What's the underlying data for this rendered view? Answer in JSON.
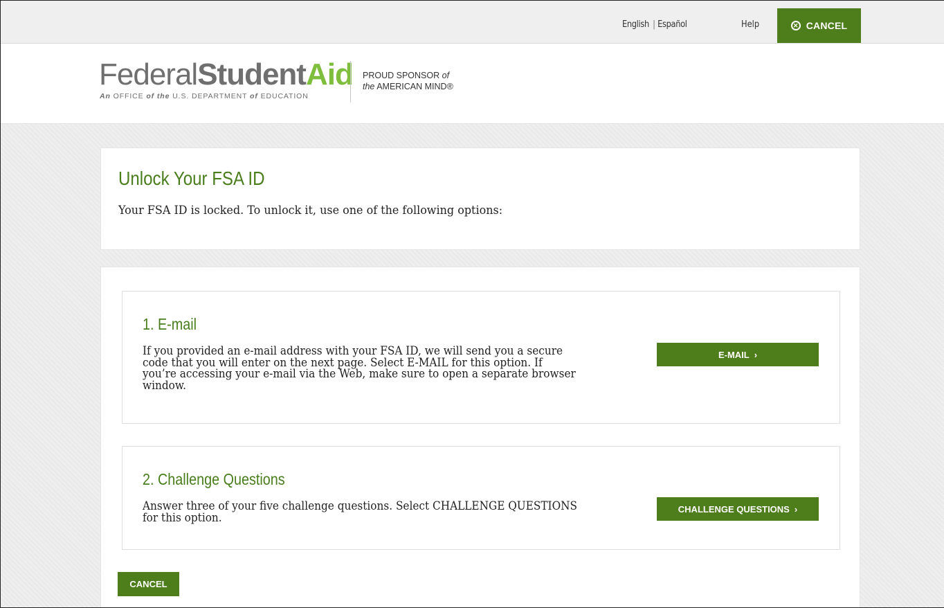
{
  "topbar": {
    "lang_english": "English",
    "lang_separator": "|",
    "lang_spanish": "Español",
    "help_label": "Help",
    "cancel_label": "CANCEL"
  },
  "header": {
    "logo_word1": "Federal",
    "logo_word2": "Student",
    "logo_word3": "Aid",
    "logo_sub_parts": [
      "An",
      "OFFICE",
      "of",
      "the",
      "U.S. DEPARTMENT",
      "of",
      "EDUCATION"
    ],
    "sponsor_line1": "PROUD SPONSOR",
    "sponsor_of": "of",
    "sponsor_the": "the",
    "sponsor_line2": "AMERICAN MIND®"
  },
  "intro": {
    "title": "Unlock Your FSA ID",
    "text": "Your FSA ID is locked. To unlock it, use one of the following options:"
  },
  "options": [
    {
      "title": "1. E-mail",
      "description": "If you provided an e-mail address with your FSA ID, we will send you a secure code that you will enter on the next page. Select E-MAIL for this option. If you’re accessing your e-mail via the Web, make sure to open a separate browser window.",
      "button_label": "E-MAIL",
      "button_chevron": "›"
    },
    {
      "title": "2. Challenge Questions",
      "description": "Answer three of your five challenge questions. Select CHALLENGE QUESTIONS for this option.",
      "button_label": "CHALLENGE QUESTIONS",
      "button_chevron": "›"
    }
  ],
  "footer": {
    "cancel_label": "CANCEL"
  },
  "colors": {
    "brand_green": "#4e7d1b",
    "logo_green": "#7fbd3c",
    "title_green": "#4a7d1c"
  }
}
